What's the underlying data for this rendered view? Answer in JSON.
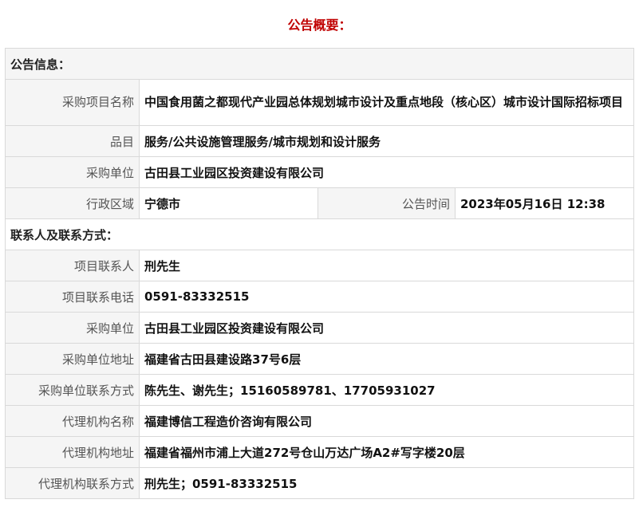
{
  "page_title": "公告概要：",
  "sections": {
    "notice_info": "公告信息：",
    "contact_info": "联系人及联系方式："
  },
  "notice": {
    "project_name_label": "采购项目名称",
    "project_name": "中国食用菌之都现代产业园总体规划城市设计及重点地段（核心区）城市设计国际招标项目",
    "category_label": "品目",
    "category": "服务/公共设施管理服务/城市规划和设计服务",
    "purchaser_label": "采购单位",
    "purchaser": "古田县工业园区投资建设有限公司",
    "region_label": "行政区域",
    "region": "宁德市",
    "time_label": "公告时间",
    "time": "2023年05月16日 12:38"
  },
  "contacts": {
    "project_contact_label": "项目联系人",
    "project_contact": "刑先生",
    "project_phone_label": "项目联系电话",
    "project_phone": "0591-83332515",
    "purchaser_label": "采购单位",
    "purchaser": "古田县工业园区投资建设有限公司",
    "purchaser_address_label": "采购单位地址",
    "purchaser_address": "福建省古田县建设路37号6层",
    "purchaser_contact_label": "采购单位联系方式",
    "purchaser_contact": "陈先生、谢先生；15160589781、17705931027",
    "agency_name_label": "代理机构名称",
    "agency_name": "福建博信工程造价咨询有限公司",
    "agency_address_label": "代理机构地址",
    "agency_address": "福建省福州市浦上大道272号仓山万达广场A2#写字楼20层",
    "agency_contact_label": "代理机构联系方式",
    "agency_contact": "刑先生；0591-83332515"
  }
}
